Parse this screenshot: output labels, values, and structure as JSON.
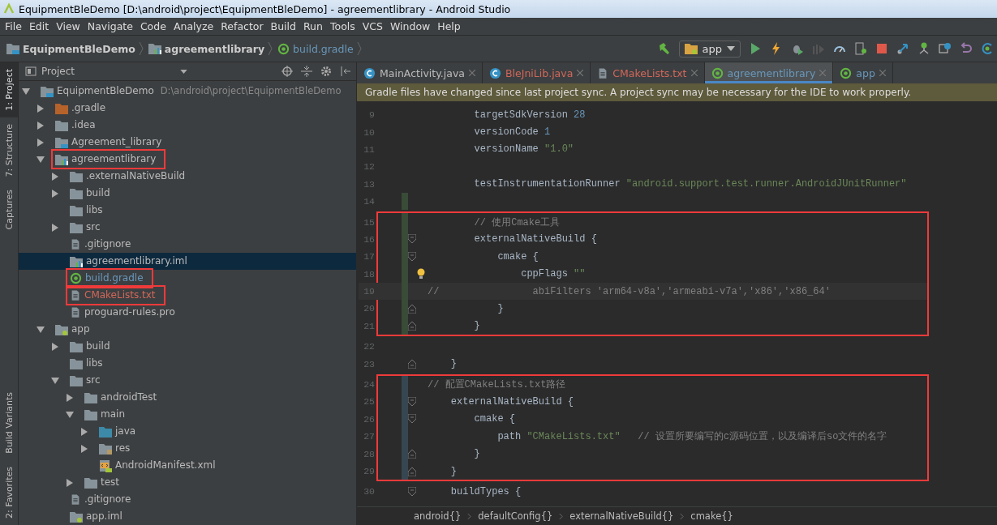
{
  "window": {
    "title": "EquipmentBleDemo [D:\\android\\project\\EquipmentBleDemo] - agreementlibrary - Android Studio"
  },
  "menu": [
    "File",
    "Edit",
    "View",
    "Navigate",
    "Code",
    "Analyze",
    "Refactor",
    "Build",
    "Run",
    "Tools",
    "VCS",
    "Window",
    "Help"
  ],
  "breadcrumb": [
    {
      "label": "EquipmentBleDemo",
      "kind": "project"
    },
    {
      "label": "agreementlibrary",
      "kind": "module"
    },
    {
      "label": "build.gradle",
      "kind": "gradle"
    }
  ],
  "run_config": {
    "value": "app"
  },
  "left_strip": {
    "top": [
      {
        "label": "1: Project",
        "selected": true
      },
      {
        "label": "7: Structure",
        "selected": false
      },
      {
        "label": "Captures",
        "selected": false
      }
    ],
    "bottom": [
      {
        "label": "Build Variants",
        "selected": false
      },
      {
        "label": "2: Favorites",
        "selected": false
      }
    ]
  },
  "project_panel": {
    "view": "Project",
    "tree": [
      {
        "name": "EquipmentBleDemo",
        "path": "D:\\android\\project\\EquipmentBleDemo",
        "kind": "project",
        "expanded": true,
        "selected": false,
        "highlighted": false,
        "color": "#bbbbbb",
        "children": [
          {
            "name": ".gradle",
            "kind": "folder-orange",
            "expanded": false,
            "selected": false,
            "highlighted": false,
            "color": "#bbbbbb"
          },
          {
            "name": ".idea",
            "kind": "folder",
            "expanded": false,
            "selected": false,
            "highlighted": false,
            "color": "#bbbbbb"
          },
          {
            "name": "Agreement_library",
            "kind": "project",
            "expanded": false,
            "selected": false,
            "highlighted": false,
            "color": "#bbbbbb"
          },
          {
            "name": "agreementlibrary",
            "kind": "module",
            "expanded": true,
            "selected": false,
            "highlighted": true,
            "color": "#bbbbbb",
            "children": [
              {
                "name": ".externalNativeBuild",
                "kind": "folder",
                "expanded": false,
                "selected": false,
                "highlighted": false,
                "color": "#bbbbbb"
              },
              {
                "name": "build",
                "kind": "folder",
                "expanded": false,
                "selected": false,
                "highlighted": false,
                "color": "#bbbbbb"
              },
              {
                "name": "libs",
                "kind": "folder",
                "selected": false,
                "highlighted": false,
                "color": "#bbbbbb"
              },
              {
                "name": "src",
                "kind": "folder",
                "expanded": false,
                "selected": false,
                "highlighted": false,
                "color": "#bbbbbb"
              },
              {
                "name": ".gitignore",
                "kind": "file",
                "selected": false,
                "highlighted": false,
                "color": "#bbbbbb"
              },
              {
                "name": "agreementlibrary.iml",
                "kind": "module",
                "selected": true,
                "highlighted": false,
                "color": "#bbbbbb"
              },
              {
                "name": "build.gradle",
                "kind": "gradle",
                "selected": false,
                "highlighted": true,
                "color": "#6897bb"
              },
              {
                "name": "CMakeLists.txt",
                "kind": "file",
                "selected": false,
                "highlighted": true,
                "color": "#d1675a"
              },
              {
                "name": "proguard-rules.pro",
                "kind": "file",
                "selected": false,
                "highlighted": false,
                "color": "#bbbbbb"
              }
            ]
          },
          {
            "name": "app",
            "kind": "app-module",
            "expanded": true,
            "selected": false,
            "highlighted": false,
            "color": "#bbbbbb",
            "children": [
              {
                "name": "build",
                "kind": "folder",
                "expanded": false,
                "selected": false,
                "highlighted": false,
                "color": "#bbbbbb"
              },
              {
                "name": "libs",
                "kind": "folder",
                "selected": false,
                "highlighted": false,
                "color": "#bbbbbb"
              },
              {
                "name": "src",
                "kind": "folder",
                "expanded": true,
                "selected": false,
                "highlighted": false,
                "color": "#bbbbbb",
                "children": [
                  {
                    "name": "androidTest",
                    "kind": "folder",
                    "expanded": false,
                    "selected": false,
                    "highlighted": false,
                    "color": "#bbbbbb"
                  },
                  {
                    "name": "main",
                    "kind": "folder",
                    "expanded": true,
                    "selected": false,
                    "highlighted": false,
                    "color": "#bbbbbb",
                    "children": [
                      {
                        "name": "java",
                        "kind": "folder-blue",
                        "expanded": false,
                        "selected": false,
                        "highlighted": false,
                        "color": "#bbbbbb"
                      },
                      {
                        "name": "res",
                        "kind": "folder-res",
                        "expanded": false,
                        "selected": false,
                        "highlighted": false,
                        "color": "#bbbbbb"
                      },
                      {
                        "name": "AndroidManifest.xml",
                        "kind": "manifest",
                        "selected": false,
                        "highlighted": false,
                        "color": "#bbbbbb"
                      }
                    ]
                  },
                  {
                    "name": "test",
                    "kind": "folder",
                    "expanded": false,
                    "selected": false,
                    "highlighted": false,
                    "color": "#bbbbbb"
                  }
                ]
              },
              {
                "name": ".gitignore",
                "kind": "file",
                "selected": false,
                "highlighted": false,
                "color": "#bbbbbb"
              },
              {
                "name": "app.iml",
                "kind": "app-module",
                "selected": false,
                "highlighted": false,
                "color": "#bbbbbb"
              }
            ]
          }
        ]
      }
    ]
  },
  "editor_tabs": [
    {
      "label": "MainActivity.java",
      "kind": "class",
      "selected": false,
      "color": "#bbbbbb"
    },
    {
      "label": "BleJniLib.java",
      "kind": "class",
      "selected": false,
      "color": "#d1675a"
    },
    {
      "label": "CMakeLists.txt",
      "kind": "file",
      "selected": false,
      "color": "#d1675a"
    },
    {
      "label": "agreementlibrary",
      "kind": "gradle",
      "selected": true,
      "color": "#6897bb"
    },
    {
      "label": "app",
      "kind": "gradle",
      "selected": false,
      "color": "#6897bb"
    }
  ],
  "notification": "Gradle files have changed since last project sync. A project sync may be necessary for the IDE to work properly.",
  "code": [
    {
      "boxed": false,
      "lines": [
        {
          "num": "9",
          "added": false,
          "modified": false,
          "fold_start": false,
          "fold_end": false,
          "tokens": [
            {
              "kind": "plain",
              "text": "        targetSdkVersion "
            },
            {
              "kind": "number",
              "text": "28"
            }
          ]
        },
        {
          "num": "10",
          "added": false,
          "modified": false,
          "fold_start": false,
          "fold_end": false,
          "tokens": [
            {
              "kind": "plain",
              "text": "        versionCode "
            },
            {
              "kind": "number",
              "text": "1"
            }
          ]
        },
        {
          "num": "11",
          "added": false,
          "modified": false,
          "fold_start": false,
          "fold_end": false,
          "tokens": [
            {
              "kind": "plain",
              "text": "        versionName "
            },
            {
              "kind": "string",
              "text": "\"1.0\""
            }
          ]
        },
        {
          "num": "12",
          "added": false,
          "modified": false,
          "fold_start": false,
          "fold_end": false
        },
        {
          "num": "13",
          "added": false,
          "modified": false,
          "fold_start": false,
          "fold_end": false,
          "tokens": [
            {
              "kind": "plain",
              "text": "        testInstrumentationRunner "
            },
            {
              "kind": "string",
              "text": "\"android.support.test.runner.AndroidJUnitRunner\""
            }
          ]
        },
        {
          "num": "14",
          "added": true,
          "modified": false,
          "fold_start": false,
          "fold_end": false
        }
      ]
    },
    {
      "boxed": true,
      "lines": [
        {
          "num": "15",
          "added": true,
          "modified": false,
          "fold_start": false,
          "fold_end": false,
          "tokens": [
            {
              "kind": "comment",
              "text": "        // 使用Cmake工具"
            }
          ]
        },
        {
          "num": "16",
          "added": true,
          "modified": false,
          "fold_start": true,
          "fold_end": false,
          "tokens": [
            {
              "kind": "plain",
              "text": "        externalNativeBuild {"
            }
          ]
        },
        {
          "num": "17",
          "added": true,
          "modified": false,
          "fold_start": true,
          "fold_end": false,
          "tokens": [
            {
              "kind": "plain",
              "text": "            cmake {"
            }
          ]
        },
        {
          "num": "18",
          "added": true,
          "modified": false,
          "fold_start": false,
          "fold_end": false,
          "bulb": true,
          "tokens": [
            {
              "kind": "plain",
              "text": "                cppFlags "
            },
            {
              "kind": "string",
              "text": "\"\""
            }
          ]
        },
        {
          "num": "19",
          "added": true,
          "modified": false,
          "fold_start": false,
          "fold_end": false,
          "current": true,
          "tokens": [
            {
              "kind": "comment",
              "text": "//                abiFilters 'arm64-v8a','armeabi-v7a','x86','x86_64'"
            }
          ]
        },
        {
          "num": "20",
          "added": true,
          "modified": false,
          "fold_start": false,
          "fold_end": true,
          "tokens": [
            {
              "kind": "plain",
              "text": "            }"
            }
          ]
        },
        {
          "num": "21",
          "added": true,
          "modified": false,
          "fold_start": false,
          "fold_end": true,
          "tokens": [
            {
              "kind": "plain",
              "text": "        }"
            }
          ]
        }
      ]
    },
    {
      "boxed": false,
      "lines": [
        {
          "num": "22",
          "added": false,
          "modified": false,
          "fold_start": false,
          "fold_end": false
        },
        {
          "num": "23",
          "added": false,
          "modified": false,
          "fold_start": false,
          "fold_end": true,
          "tokens": [
            {
              "kind": "plain",
              "text": "    }"
            }
          ]
        }
      ]
    },
    {
      "boxed": true,
      "lines": [
        {
          "num": "24",
          "added": false,
          "modified": true,
          "fold_start": false,
          "fold_end": false,
          "tokens": [
            {
              "kind": "comment",
              "text": "// 配置CMakeLists.txt路径"
            }
          ]
        },
        {
          "num": "25",
          "added": false,
          "modified": true,
          "fold_start": true,
          "fold_end": false,
          "tokens": [
            {
              "kind": "plain",
              "text": "    externalNativeBuild {"
            }
          ]
        },
        {
          "num": "26",
          "added": false,
          "modified": true,
          "fold_start": true,
          "fold_end": false,
          "tokens": [
            {
              "kind": "plain",
              "text": "        cmake {"
            }
          ]
        },
        {
          "num": "27",
          "added": false,
          "modified": true,
          "fold_start": false,
          "fold_end": false,
          "tokens": [
            {
              "kind": "plain",
              "text": "            path "
            },
            {
              "kind": "string",
              "text": "\"CMakeLists.txt\""
            },
            {
              "kind": "comment",
              "text": "   // 设置所要编写的c源码位置，以及编译后so文件的名字"
            }
          ]
        },
        {
          "num": "28",
          "added": false,
          "modified": true,
          "fold_start": false,
          "fold_end": true,
          "tokens": [
            {
              "kind": "plain",
              "text": "        }"
            }
          ]
        },
        {
          "num": "29",
          "added": false,
          "modified": true,
          "fold_start": false,
          "fold_end": true,
          "tokens": [
            {
              "kind": "plain",
              "text": "    }"
            }
          ]
        }
      ]
    },
    {
      "boxed": false,
      "lines": [
        {
          "num": "30",
          "added": false,
          "modified": false,
          "fold_start": true,
          "fold_end": false,
          "tokens": [
            {
              "kind": "plain",
              "text": "    buildTypes {"
            }
          ]
        }
      ]
    }
  ],
  "editor_breadcrumb": [
    "android{}",
    "defaultConfig{}",
    "externalNativeBuild{}",
    "cmake{}"
  ]
}
